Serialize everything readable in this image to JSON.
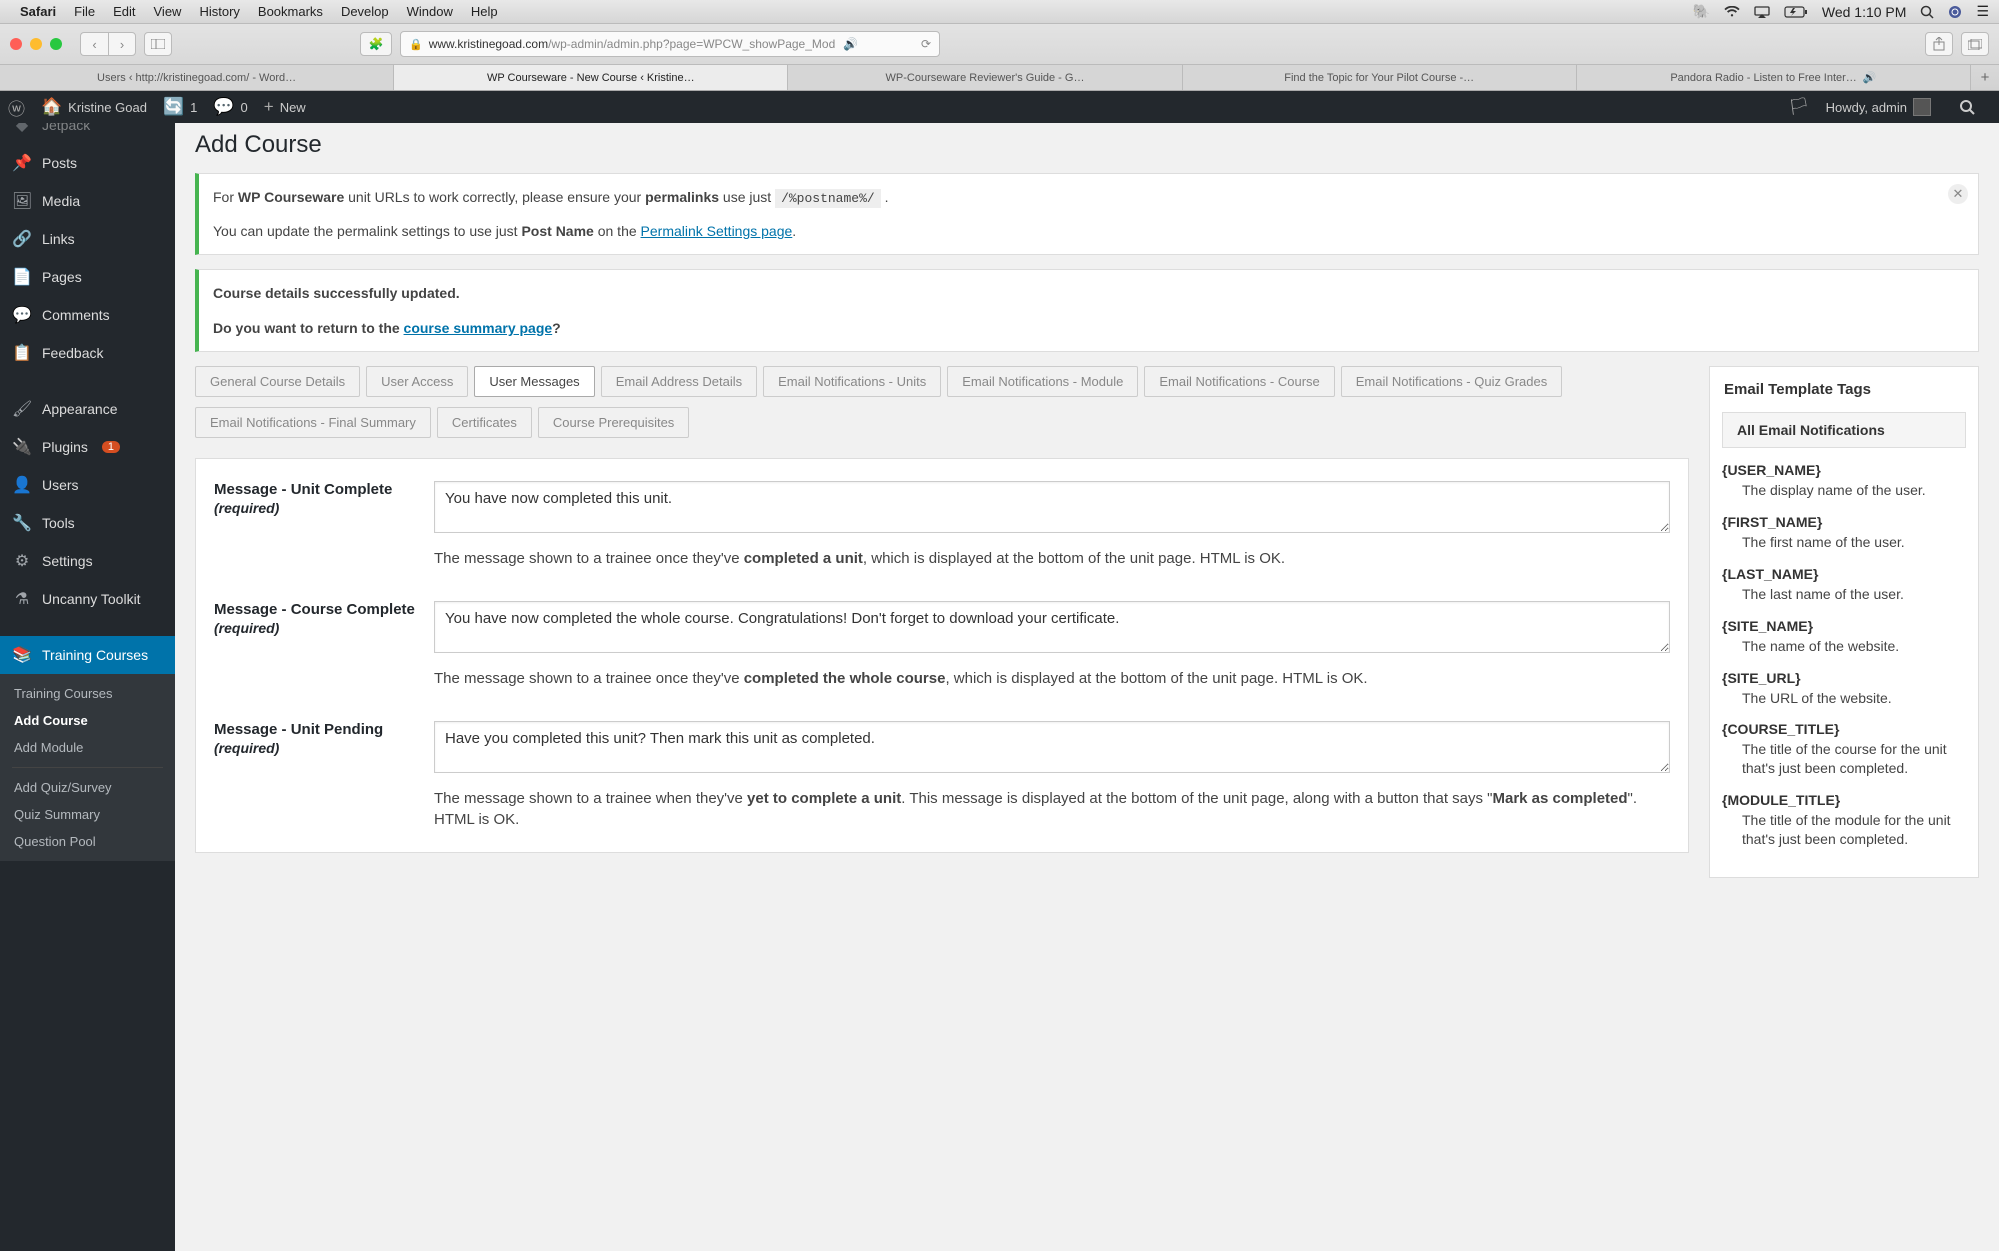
{
  "mac_menu": {
    "app": "Safari",
    "items": [
      "File",
      "Edit",
      "View",
      "History",
      "Bookmarks",
      "Develop",
      "Window",
      "Help"
    ],
    "clock": "Wed 1:10 PM"
  },
  "safari": {
    "url_domain": "www.kristinegoad.com",
    "url_path": "/wp-admin/admin.php?page=WPCW_showPage_Mod",
    "tabs": [
      "Users ‹ http://kristinegoad.com/ - Word…",
      "WP Courseware - New Course ‹ Kristine…",
      "WP-Courseware Reviewer's Guide - G…",
      "Find the Topic for Your Pilot Course -…",
      "Pandora Radio - Listen to Free Inter…"
    ],
    "active_tab": 1
  },
  "wp_bar": {
    "site": "Kristine Goad",
    "updates": "1",
    "comments": "0",
    "new": "New",
    "howdy": "Howdy, admin"
  },
  "sidebar": {
    "items": [
      {
        "icon": "📌",
        "label": "Posts"
      },
      {
        "icon": "🖼",
        "label": "Media"
      },
      {
        "icon": "🔗",
        "label": "Links"
      },
      {
        "icon": "📄",
        "label": "Pages"
      },
      {
        "icon": "💬",
        "label": "Comments"
      },
      {
        "icon": "📋",
        "label": "Feedback"
      }
    ],
    "items2": [
      {
        "icon": "🖌",
        "label": "Appearance"
      },
      {
        "icon": "🔌",
        "label": "Plugins",
        "badge": "1"
      },
      {
        "icon": "👤",
        "label": "Users"
      },
      {
        "icon": "🔧",
        "label": "Tools"
      },
      {
        "icon": "⚙",
        "label": "Settings"
      },
      {
        "icon": "⚗",
        "label": "Uncanny Toolkit"
      }
    ],
    "current": {
      "icon": "📚",
      "label": "Training Courses"
    },
    "submenu": [
      "Training Courses",
      "Add Course",
      "Add Module",
      "Add Quiz/Survey",
      "Quiz Summary",
      "Question Pool"
    ],
    "submenu_current": 1
  },
  "page": {
    "title": "Add Course",
    "notice1_a": "For ",
    "notice1_b": "WP Courseware",
    "notice1_c": " unit URLs to work correctly, please ensure your ",
    "notice1_d": "permalinks",
    "notice1_e": " use just ",
    "notice1_code": "/%postname%/",
    "notice1_f": " .",
    "notice1_line2a": "You can update the permalink settings to use just ",
    "notice1_line2b": "Post Name",
    "notice1_line2c": " on the ",
    "notice1_link": "Permalink Settings page",
    "notice1_line2d": ".",
    "notice2": "Course details successfully updated.",
    "notice3a": "Do you want to return to the ",
    "notice3_link": "course summary page",
    "notice3b": "?",
    "tabs": [
      "General Course Details",
      "User Access",
      "User Messages",
      "Email Address Details",
      "Email Notifications - Units",
      "Email Notifications - Module",
      "Email Notifications - Course",
      "Email Notifications - Quiz Grades",
      "Email Notifications - Final Summary",
      "Certificates",
      "Course Prerequisites"
    ],
    "active_tab": 2,
    "fields": [
      {
        "label": "Message - Unit Complete",
        "req": "(required)",
        "value": "You have now completed this unit.",
        "desc_a": "The message shown to a trainee once they've ",
        "desc_b": "completed a unit",
        "desc_c": ", which is displayed at the bottom of the unit page. HTML is OK."
      },
      {
        "label": "Message - Course Complete",
        "req": "(required)",
        "value": "You have now completed the whole course. Congratulations! Don't forget to download your certificate.",
        "desc_a": "The message shown to a trainee once they've ",
        "desc_b": "completed the whole course",
        "desc_c": ", which is displayed at the bottom of the unit page. HTML is OK."
      },
      {
        "label": "Message - Unit Pending",
        "req": "(required)",
        "value": "Have you completed this unit? Then mark this unit as completed.",
        "desc_a": "The message shown to a trainee when they've ",
        "desc_b": "yet to complete a unit",
        "desc_c": ". This message is displayed at the bottom of the unit page, along with a button that says \"",
        "desc_d": "Mark as completed",
        "desc_e": "\". HTML is OK."
      }
    ],
    "sidebar_box": {
      "title": "Email Template Tags",
      "accordion": "All Email Notifications",
      "tags": [
        {
          "tag": "{USER_NAME}",
          "desc": "The display name of the user."
        },
        {
          "tag": "{FIRST_NAME}",
          "desc": "The first name of the user."
        },
        {
          "tag": "{LAST_NAME}",
          "desc": "The last name of the user."
        },
        {
          "tag": "{SITE_NAME}",
          "desc": "The name of the website."
        },
        {
          "tag": "{SITE_URL}",
          "desc": "The URL of the website."
        },
        {
          "tag": "{COURSE_TITLE}",
          "desc": "The title of the course for the unit that's just been completed."
        },
        {
          "tag": "{MODULE_TITLE}",
          "desc": "The title of the module for the unit that's just been completed."
        }
      ]
    }
  }
}
